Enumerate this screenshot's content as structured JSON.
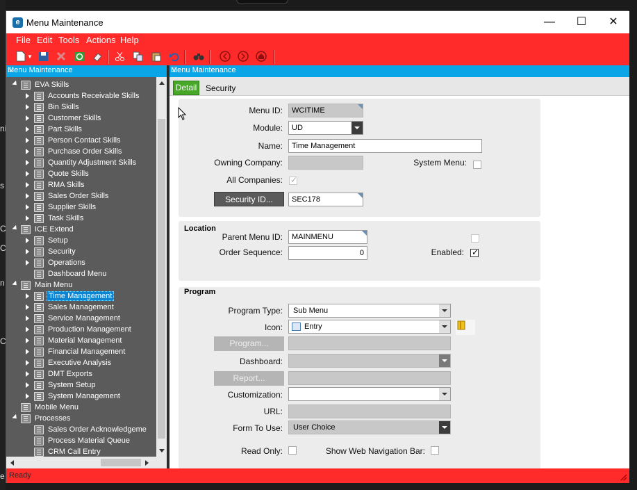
{
  "window": {
    "title": "Menu Maintenance",
    "minimize": "—",
    "maximize": "☐",
    "close": "✕"
  },
  "menubar": [
    "File",
    "Edit",
    "Tools",
    "Actions",
    "Help"
  ],
  "left_panel": {
    "title": "Menu Maintenance",
    "tree": [
      {
        "label": "EVA Skills",
        "level": 0,
        "expanded": true
      },
      {
        "label": "Accounts Receivable Skills",
        "level": 1
      },
      {
        "label": "Bin Skills",
        "level": 1
      },
      {
        "label": "Customer Skills",
        "level": 1
      },
      {
        "label": "Part Skills",
        "level": 1
      },
      {
        "label": "Person Contact Skills",
        "level": 1
      },
      {
        "label": "Purchase Order Skills",
        "level": 1
      },
      {
        "label": "Quantity Adjustment Skills",
        "level": 1
      },
      {
        "label": "Quote Skills",
        "level": 1
      },
      {
        "label": "RMA Skills",
        "level": 1
      },
      {
        "label": "Sales Order Skills",
        "level": 1
      },
      {
        "label": "Supplier Skills",
        "level": 1
      },
      {
        "label": "Task Skills",
        "level": 1
      },
      {
        "label": "ICE Extend",
        "level": 0,
        "expanded": true
      },
      {
        "label": "Setup",
        "level": 1
      },
      {
        "label": "Security",
        "level": 1
      },
      {
        "label": "Operations",
        "level": 1
      },
      {
        "label": "Dashboard Menu",
        "level": 1,
        "leaf": true
      },
      {
        "label": "Main Menu",
        "level": 0,
        "expanded": true
      },
      {
        "label": "Time Management",
        "level": 1,
        "selected": true
      },
      {
        "label": "Sales Management",
        "level": 1
      },
      {
        "label": "Service Management",
        "level": 1
      },
      {
        "label": "Production Management",
        "level": 1
      },
      {
        "label": "Material Management",
        "level": 1
      },
      {
        "label": "Financial Management",
        "level": 1
      },
      {
        "label": "Executive Analysis",
        "level": 1
      },
      {
        "label": "DMT Exports",
        "level": 1
      },
      {
        "label": "System Setup",
        "level": 1
      },
      {
        "label": "System Management",
        "level": 1
      },
      {
        "label": "Mobile Menu",
        "level": 0,
        "leaf": true
      },
      {
        "label": "Processes",
        "level": 0,
        "expanded": true
      },
      {
        "label": "Sales Order Acknowledgeme",
        "level": 1,
        "leaf": true
      },
      {
        "label": "Process Material Queue",
        "level": 1,
        "leaf": true
      },
      {
        "label": "CRM Call Entry",
        "level": 1,
        "leaf": true
      }
    ]
  },
  "right_panel": {
    "title": "Menu Maintenance",
    "tabs": [
      "Detail",
      "Security"
    ],
    "general": {
      "menu_id_label": "Menu ID:",
      "menu_id": "WCITIME",
      "module_label": "Module:",
      "module": "UD",
      "name_label": "Name:",
      "name": "Time Management",
      "owning_company_label": "Owning Company:",
      "owning_company": "",
      "system_menu_label": "System Menu:",
      "all_companies_label": "All Companies:",
      "security_id_button": "Security ID...",
      "security_id": "SEC178"
    },
    "location": {
      "title": "Location",
      "parent_menu_id_label": "Parent Menu ID:",
      "parent_menu_id": "MAINMENU",
      "order_sequence_label": "Order Sequence:",
      "order_sequence": "0",
      "enabled_label": "Enabled:"
    },
    "program": {
      "title": "Program",
      "program_type_label": "Program Type:",
      "program_type": "Sub Menu",
      "icon_label": "Icon:",
      "icon": "Entry",
      "program_button": "Program...",
      "program": "",
      "dashboard_label": "Dashboard:",
      "dashboard": "",
      "report_button": "Report...",
      "report": "",
      "customization_label": "Customization:",
      "customization": "",
      "url_label": "URL:",
      "url": "",
      "form_to_use_label": "Form To Use:",
      "form_to_use": "User Choice",
      "read_only_label": "Read Only:",
      "show_web_nav_label": "Show Web Navigation Bar:"
    }
  },
  "status": {
    "text": "Ready"
  },
  "background_fragments": [
    "ni",
    "s",
    "C",
    "C",
    "n",
    "C",
    "e"
  ]
}
